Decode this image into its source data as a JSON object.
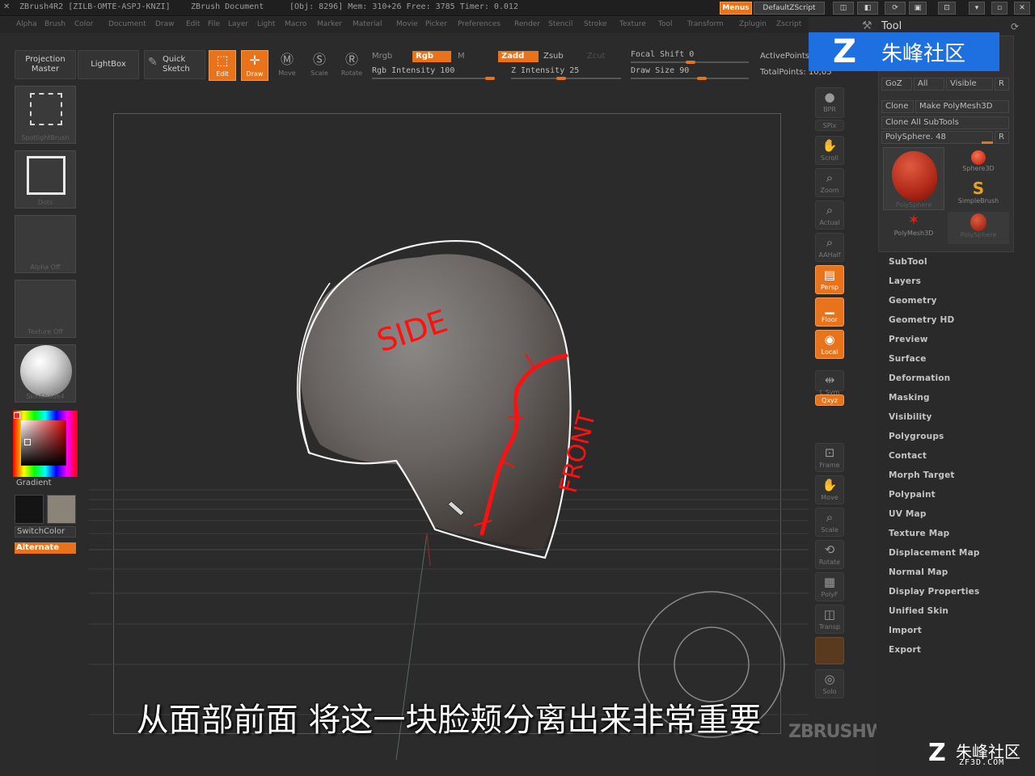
{
  "titlebar": {
    "app": "ZBrush4R2 [ZILB-OMTE-ASPJ-KNZI]",
    "document": "ZBrush Document",
    "stats": "[Obj: 8296] Mem: 310+26 Free: 3785 Timer: 0.012",
    "menus_label": "Menus",
    "script_label": "DefaultZScript"
  },
  "menubar": [
    "Alpha",
    "Brush",
    "Color",
    "Document",
    "Draw",
    "Edit",
    "File",
    "Layer",
    "Light",
    "Macro",
    "Marker",
    "Material",
    "Movie",
    "Picker",
    "Preferences",
    "Render",
    "Stencil",
    "Stroke",
    "Texture",
    "Tool",
    "Transform",
    "Zplugin",
    "Zscript"
  ],
  "shelf": {
    "projection_master": "Projection Master",
    "lightbox": "LightBox",
    "quick_sketch": "Quick Sketch",
    "edit": "Edit",
    "draw": "Draw",
    "move": "Move",
    "scale": "Scale",
    "rotate": "Rotate",
    "mrgb": "Mrgb",
    "rgb": "Rgb",
    "m": "M",
    "rgb_intensity": "Rgb Intensity 100",
    "zadd": "Zadd",
    "zsub": "Zsub",
    "zcut": "Zcut",
    "z_intensity": "Z Intensity 25",
    "focal_shift": "Focal Shift 0",
    "draw_size": "Draw Size 90",
    "active_points": "ActivePoints:",
    "total_points": "TotalPoints: 10,05"
  },
  "left": {
    "tile1": "SpotlightBrush",
    "tile2": "Dots",
    "tile3": "Alpha Off",
    "tile4": "Texture Off",
    "tile5": "SkinShade4",
    "gradient": "Gradient",
    "switch_color": "SwitchColor",
    "alternate": "Alternate",
    "colors": {
      "primary": "#141414",
      "secondary": "#8a8378",
      "accent": "#e8731a"
    }
  },
  "canvas": {
    "annotation_side": "SIDE",
    "annotation_front": "FRONT"
  },
  "right_toolbar": [
    "BPR",
    "SPix",
    "Scroll",
    "Zoom",
    "Actual",
    "AAHalf",
    "Persp",
    "Floor",
    "Local",
    "L.Sym",
    "Qxyz",
    "Frame",
    "Move",
    "Scale",
    "Rotate",
    "PolyF",
    "Transp",
    "Solo"
  ],
  "tool_panel": {
    "title": "Tool",
    "goz": "GoZ",
    "all": "All",
    "visible": "Visible",
    "r": "R",
    "clone": "Clone",
    "make_polymesh": "Make PolyMesh3D",
    "clone_all": "Clone All SubTools",
    "polysphere_label": "PolySphere. 48",
    "thumbs": [
      "PolySphere",
      "Sphere3D",
      "SimpleBrush",
      "PolyMesh3D",
      "PolySphere"
    ],
    "menu": [
      "SubTool",
      "Layers",
      "Geometry",
      "Geometry HD",
      "Preview",
      "Surface",
      "Deformation",
      "Masking",
      "Visibility",
      "Polygroups",
      "Contact",
      "Morph Target",
      "Polypaint",
      "UV Map",
      "Texture Map",
      "Displacement Map",
      "Normal Map",
      "Display Properties",
      "Unified Skin",
      "Import",
      "Export"
    ]
  },
  "watermark": {
    "top": "朱峰社区",
    "bottom_cn": "朱峰社区",
    "bottom_url": "ZF3D.COM",
    "workshops": "ZBRUSHWORKSHOPS"
  },
  "subtitle": "从面部前面  将这一块脸颊分离出来非常重要"
}
